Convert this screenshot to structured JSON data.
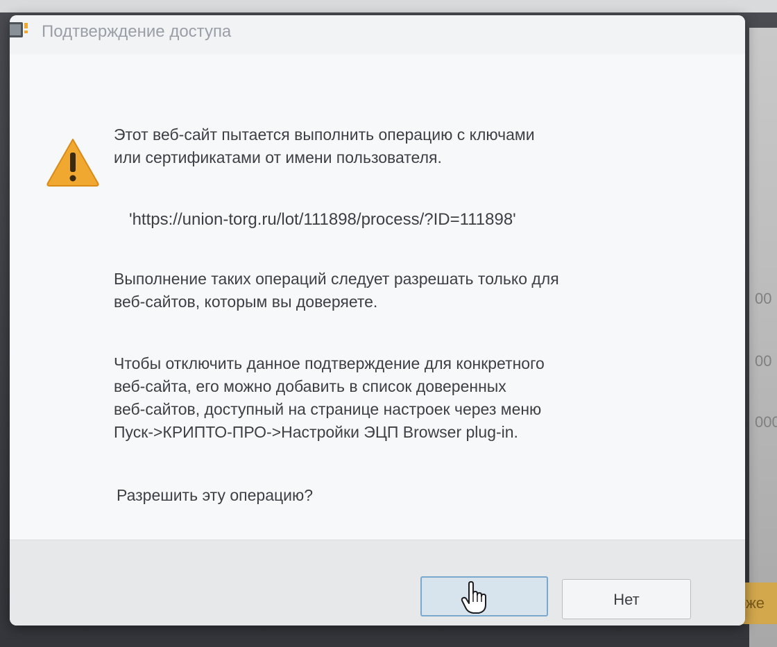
{
  "dialog": {
    "title": "Подтверждение доступа",
    "message_line1": "Этот веб-сайт пытается выполнить операцию с ключами",
    "message_line2": "или сертификатами от имени пользователя.",
    "url": "'https://union-torg.ru/lot/111898/process/?ID=111898'",
    "trust_line1": "Выполнение таких операций следует разрешать только для",
    "trust_line2": "веб-сайтов, которым вы доверяете.",
    "disable_line1": "Чтобы отключить данное подтверждение для конкретного",
    "disable_line2": "веб-сайта, его можно добавить в список доверенных",
    "disable_line3": "веб-сайтов, доступный на странице настроек через меню",
    "disable_line4": "Пуск->КРИПТО-ПРО->Настройки ЭЦП Browser plug-in.",
    "question": "Разрешить эту операцию?",
    "buttons": {
      "yes_label": "",
      "no_label": "Нет"
    },
    "icons": {
      "title": "app-window-icon",
      "warning": "warning-icon",
      "cursor": "hand-cursor-icon"
    },
    "colors": {
      "warning_fill": "#f0a830",
      "default_button_border": "#7aa7cc"
    }
  },
  "background": {
    "right_values": [
      "00",
      "00",
      "000"
    ],
    "right_button_label": "ложе"
  }
}
